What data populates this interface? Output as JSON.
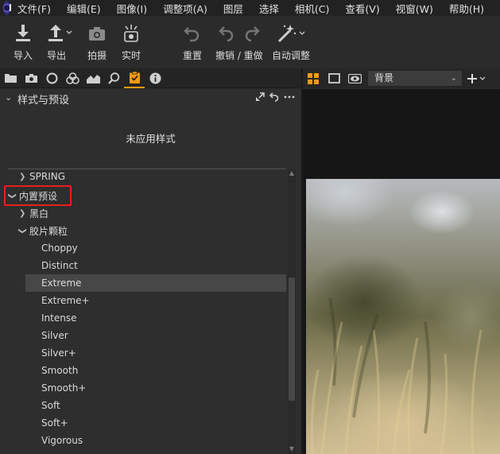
{
  "menu": [
    "文件(F)",
    "编辑(E)",
    "图像(I)",
    "调整项(A)",
    "图层",
    "选择",
    "相机(C)",
    "查看(V)",
    "视窗(W)",
    "帮助(H)"
  ],
  "toolbar": {
    "import": "导入",
    "export": "导出",
    "capture": "拍摄",
    "live": "实时",
    "reset": "重置",
    "undo_redo": "撤销 / 重做",
    "auto_adjust": "自动调整"
  },
  "viewer_toolbar": {
    "layer_select": "背景"
  },
  "panel": {
    "title": "样式与预设",
    "no_style": "未应用样式"
  },
  "tree": {
    "spring": "SPRING",
    "builtin_presets": "内置预设",
    "bw": "黑白",
    "film_grain": "胶片颗粒",
    "items": [
      "Choppy",
      "Distinct",
      "Extreme",
      "Extreme+",
      "Intense",
      "Silver",
      "Silver+",
      "Smooth",
      "Smooth+",
      "Soft",
      "Soft+",
      "Vigorous"
    ],
    "selected": "Extreme"
  },
  "colors": {
    "accent": "#f39a12",
    "highlight": "#e8201e"
  }
}
